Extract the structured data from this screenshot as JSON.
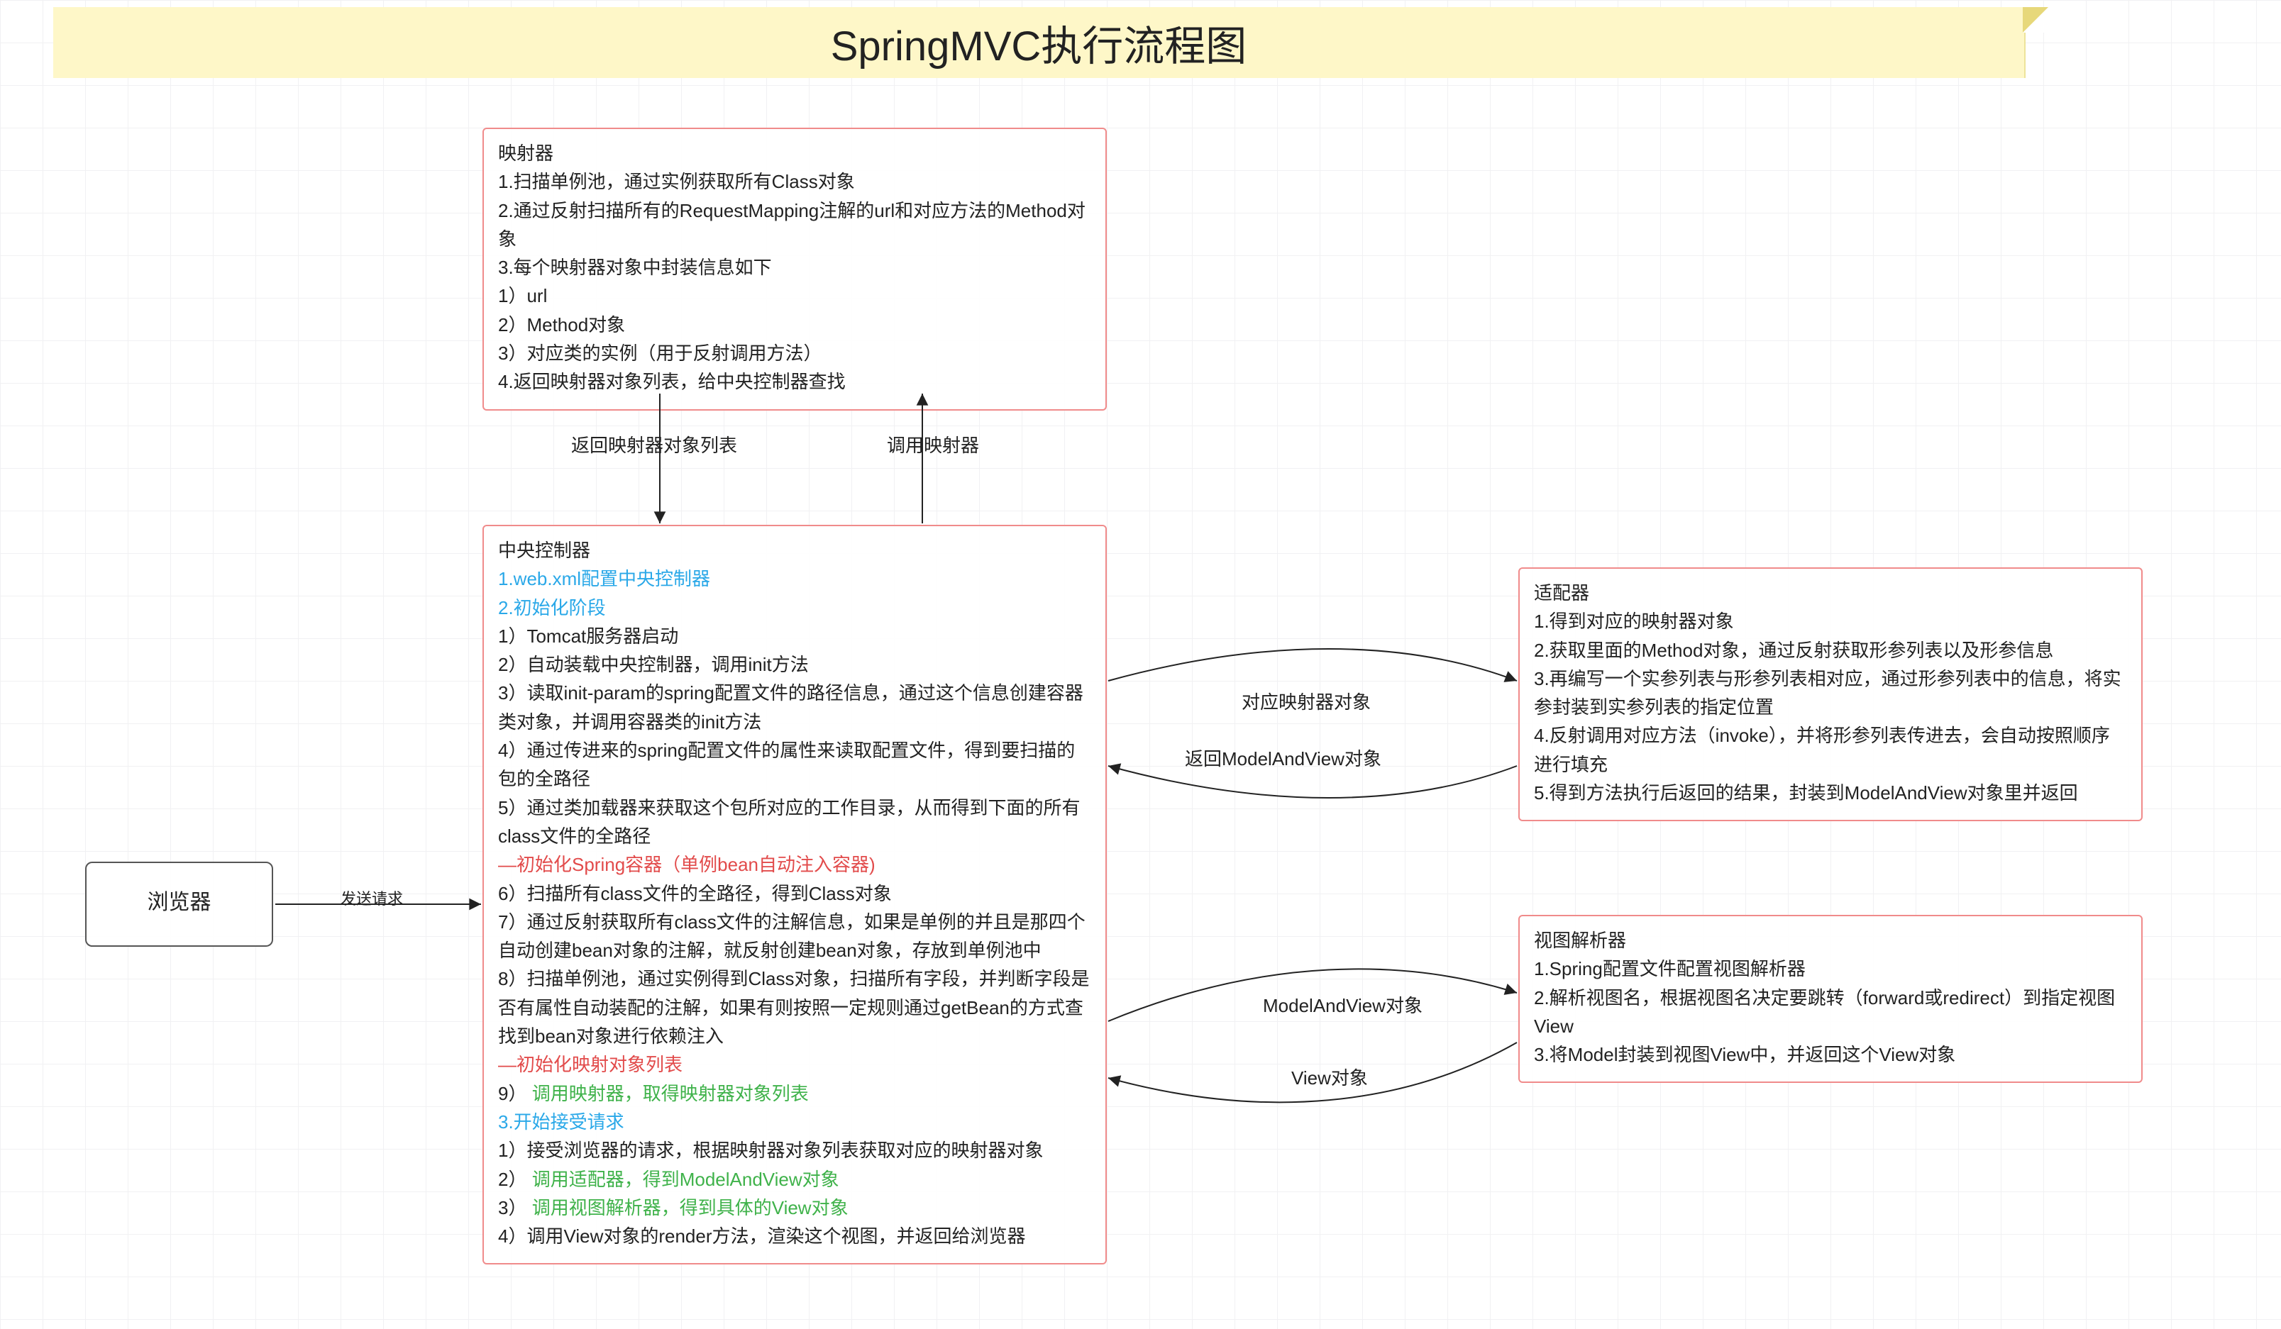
{
  "title": "SpringMVC执行流程图",
  "nodes": {
    "browser": {
      "label": "浏览器"
    },
    "mapper": {
      "heading": "映射器",
      "lines": [
        "1.扫描单例池，通过实例获取所有Class对象",
        "2.通过反射扫描所有的RequestMapping注解的url和对应方法的Method对象",
        "3.每个映射器对象中封装信息如下",
        "1）url",
        "2）Method对象",
        "3）对应类的实例（用于反射调用方法）",
        "4.返回映射器对象列表，给中央控制器查找"
      ]
    },
    "dispatcher": {
      "heading": "中央控制器",
      "blue1": "1.web.xml配置中央控制器",
      "blue2": "2.初始化阶段",
      "l1": "1）Tomcat服务器启动",
      "l2": "2）自动装载中央控制器，调用init方法",
      "l3": "3）读取init-param的spring配置文件的路径信息，通过这个信息创建容器类对象，并调用容器类的init方法",
      "l4": "4）通过传进来的spring配置文件的属性来读取配置文件，得到要扫描的包的全路径",
      "l5": "5）通过类加载器来获取这个包所对应的工作目录，从而得到下面的所有class文件的全路径",
      "red1": "—初始化Spring容器（单例bean自动注入容器)",
      "l6": "6）扫描所有class文件的全路径，得到Class对象",
      "l7": "7）通过反射获取所有class文件的注解信息，如果是单例的并且是那四个自动创建bean对象的注解，就反射创建bean对象，存放到单例池中",
      "l8": "8）扫描单例池，通过实例得到Class对象，扫描所有字段，并判断字段是否有属性自动装配的注解，如果有则按照一定规则通过getBean的方式查找到bean对象进行依赖注入",
      "red2": "—初始化映射对象列表",
      "l9a": "9）",
      "l9b": "调用映射器，取得映射器对象列表",
      "blue3": "3.开始接受请求",
      "l10": "1）接受浏览器的请求，根据映射器对象列表获取对应的映射器对象",
      "l11a": "2）",
      "l11b": "调用适配器，得到ModelAndView对象",
      "l12a": "3）",
      "l12b": "调用视图解析器，得到具体的View对象",
      "l13": "4）调用View对象的render方法，渲染这个视图，并返回给浏览器"
    },
    "adapter": {
      "heading": "适配器",
      "lines": [
        "1.得到对应的映射器对象",
        "2.获取里面的Method对象，通过反射获取形参列表以及形参信息",
        "3.再编写一个实参列表与形参列表相对应，通过形参列表中的信息，将实参封装到实参列表的指定位置",
        "4.反射调用对应方法（invoke），并将形参列表传进去，会自动按照顺序进行填充",
        "5.得到方法执行后返回的结果，封装到ModelAndView对象里并返回"
      ]
    },
    "viewresolver": {
      "heading": "视图解析器",
      "lines": [
        "1.Spring配置文件配置视图解析器",
        "2.解析视图名，根据视图名决定要跳转（forward或redirect）到指定视图View",
        "3.将Model封装到视图View中，并返回这个View对象"
      ]
    }
  },
  "edges": {
    "send_request": "发送请求",
    "return_mapper_list": "返回映射器对象列表",
    "call_mapper": "调用映射器",
    "to_adapter": "对应映射器对象",
    "from_adapter": "返回ModelAndView对象",
    "to_viewresolver": "ModelAndView对象",
    "from_viewresolver": "View对象"
  }
}
